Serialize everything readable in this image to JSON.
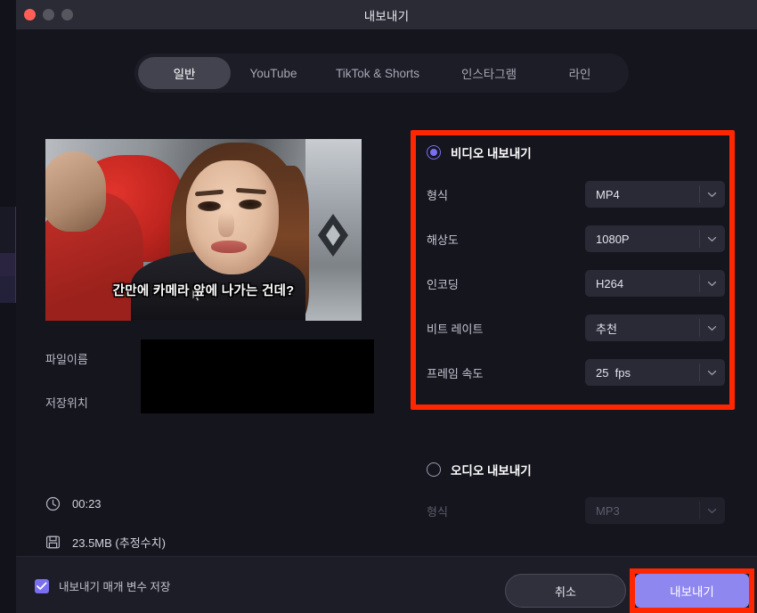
{
  "window": {
    "title": "내보내기",
    "traffic_lights": [
      "close-red",
      "minimize-gray",
      "maximize-gray"
    ]
  },
  "tabs": [
    {
      "label": "일반",
      "active": true
    },
    {
      "label": "YouTube",
      "active": false
    },
    {
      "label": "TikTok & Shorts",
      "active": false
    },
    {
      "label": "인스타그램",
      "active": false
    },
    {
      "label": "라인",
      "active": false
    }
  ],
  "preview": {
    "subtitle": "간만에 카메라 앞에 나가는 건데?"
  },
  "file_fields": {
    "filename_label": "파일이름",
    "filename_value": "",
    "savepath_label": "저장위치",
    "savepath_value": ""
  },
  "info": {
    "duration_icon": "clock-icon",
    "duration": "00:23",
    "size_icon": "save-disk-icon",
    "size": "23.5MB (추정수치)"
  },
  "video_export": {
    "radio_label": "비디오 내보내기",
    "selected": true,
    "settings": [
      {
        "label": "형식",
        "value": "MP4"
      },
      {
        "label": "해상도",
        "value": "1080P"
      },
      {
        "label": "인코딩",
        "value": "H264"
      },
      {
        "label": "비트 레이트",
        "value": "추천"
      },
      {
        "label": "프레임 속도",
        "value": "25  fps"
      }
    ]
  },
  "audio_export": {
    "radio_label": "오디오 내보내기",
    "selected": false,
    "settings": [
      {
        "label": "형식",
        "value": "MP3"
      }
    ]
  },
  "footer": {
    "save_params_label": "내보내기 매개 변수 저장",
    "save_params_checked": true,
    "cancel_label": "취소",
    "export_label": "내보내기"
  },
  "colors": {
    "accent_purple": "#7a6ff0",
    "export_button": "#8f87f0",
    "annotation_red": "#ff2600",
    "window_bg": "#15151e",
    "titlebar_bg": "#2b2b36"
  }
}
